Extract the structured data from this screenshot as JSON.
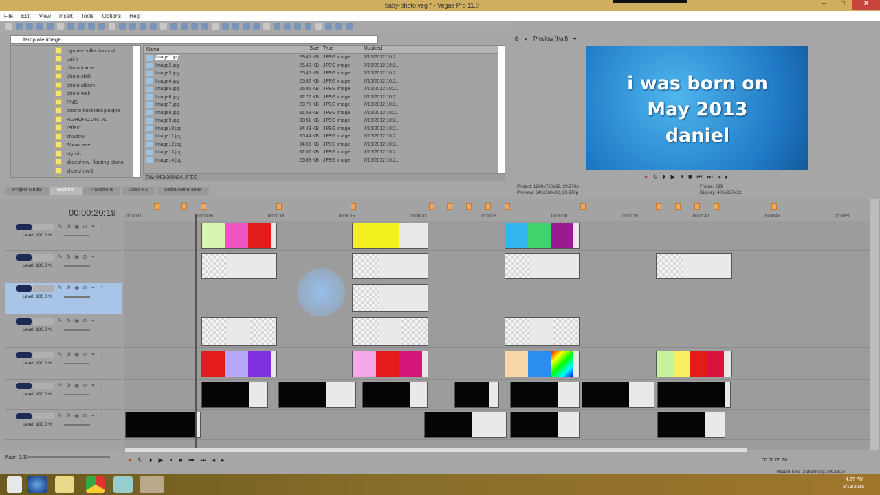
{
  "window": {
    "title": "baby-photo.veg * - Vegas Pro 11.0",
    "minimize": "–",
    "maximize": "□",
    "close": "✕"
  },
  "menu": [
    "File",
    "Edit",
    "View",
    "Insert",
    "Tools",
    "Options",
    "Help"
  ],
  "explorer": {
    "address": "template image",
    "tree": [
      "ngoner-collection-cs2",
      "paint",
      "photo frame",
      "photo slide",
      "photo album",
      "photo wall",
      "PNG",
      "promo business people",
      "RGHORIZONTAL",
      "reflect",
      "shadow",
      "Showcase",
      "stylish",
      "slideshow- floating photo",
      "slideshow-2",
      "template image"
    ],
    "columns": [
      "Name",
      "Size",
      "Type",
      "Modified"
    ],
    "files": [
      {
        "name": "Image1.jpg",
        "size": "29.45 KB",
        "type": "JPEG image",
        "modified": "7/16/2012 10:2..."
      },
      {
        "name": "Image2.jpg",
        "size": "25.49 KB",
        "type": "JPEG image",
        "modified": "7/16/2012 10:2..."
      },
      {
        "name": "Image3.jpg",
        "size": "25.45 KB",
        "type": "JPEG image",
        "modified": "7/16/2012 10:2..."
      },
      {
        "name": "Image4.jpg",
        "size": "25.82 KB",
        "type": "JPEG image",
        "modified": "7/16/2012 10:2..."
      },
      {
        "name": "Image5.jpg",
        "size": "26.85 KB",
        "type": "JPEG image",
        "modified": "7/16/2012 10:2..."
      },
      {
        "name": "Image6.jpg",
        "size": "32.77 KB",
        "type": "JPEG image",
        "modified": "7/16/2012 10:2..."
      },
      {
        "name": "Image7.jpg",
        "size": "29.75 KB",
        "type": "JPEG image",
        "modified": "7/16/2012 10:2..."
      },
      {
        "name": "Image8.jpg",
        "size": "31.53 KB",
        "type": "JPEG image",
        "modified": "7/16/2012 10:2..."
      },
      {
        "name": "Image9.jpg",
        "size": "30.51 KB",
        "type": "JPEG image",
        "modified": "7/16/2012 10:2..."
      },
      {
        "name": "Image10.jpg",
        "size": "34.43 KB",
        "type": "JPEG image",
        "modified": "7/16/2012 10:2..."
      },
      {
        "name": "Image11.jpg",
        "size": "30.44 KB",
        "type": "JPEG image",
        "modified": "7/16/2012 10:2..."
      },
      {
        "name": "Image12.jpg",
        "size": "34.55 KB",
        "type": "JPEG image",
        "modified": "7/16/2012 10:2..."
      },
      {
        "name": "Image13.jpg",
        "size": "32.07 KB",
        "type": "JPEG image",
        "modified": "7/16/2012 10:2..."
      },
      {
        "name": "Image14.jpg",
        "size": "25.83 KB",
        "type": "JPEG image",
        "modified": "7/16/2012 10:2..."
      }
    ],
    "status": "SW: 640x360x24, JPEG",
    "tabs": [
      "Project Media",
      "Explorer",
      "Transitions",
      "Video FX",
      "Media Generators"
    ],
    "active_tab": "Explorer"
  },
  "preview": {
    "quality": "Preview (Half)",
    "lines": [
      "i was born on",
      "May 2013",
      "daniel"
    ],
    "project_label": "Project:",
    "project": "1280x720x32, 29.970p",
    "preview_label": "Preview:",
    "preview": "640x360x32, 29.970p",
    "frame_label": "Frame:",
    "frame": "299",
    "display_label": "Display:",
    "display": "405x227x32"
  },
  "timeline": {
    "timecode": "00:00:20:19",
    "ruler": [
      "00:00:00",
      "00:00:05",
      "00:00:10",
      "00:00:15",
      "00:00:20",
      "00:00:25",
      "00:00:30",
      "00:00:35",
      "00:00:40",
      "00:00:45",
      "00:00:50"
    ],
    "tracks": [
      {
        "level": "Level: 100.0 %"
      },
      {
        "level": "Level: 100.0 %"
      },
      {
        "level": "Level: 100.0 %"
      },
      {
        "level": "Level: 100.0 %"
      },
      {
        "level": "Level: 100.0 %"
      },
      {
        "level": "Level: 100.0 %"
      },
      {
        "level": "Level: 100.0 %"
      }
    ],
    "selected_track": 2
  },
  "bottom": {
    "rate": "Rate: 0.00",
    "cursor_time": "00:00:05:26",
    "record_time": "Record Time (2 channels): 309:18:10"
  },
  "taskbar": {
    "time": "4:27 PM",
    "date": "3/19/2015"
  }
}
